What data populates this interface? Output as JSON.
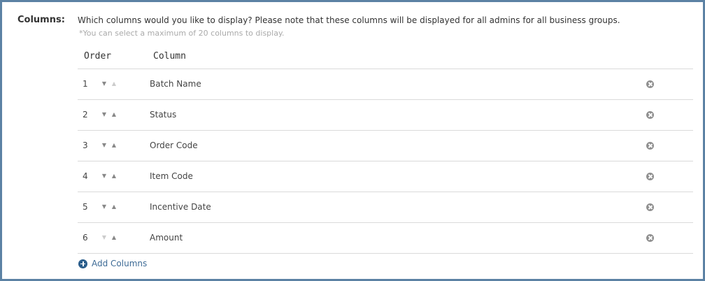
{
  "section_label": "Columns:",
  "description": "Which columns would you like to display? Please note that these columns will be displayed for all admins for all business groups.",
  "note": "*You can select a maximum of 20 columns to display.",
  "headers": {
    "order": "Order",
    "column": "Column"
  },
  "rows": [
    {
      "order": "1",
      "name": "Batch Name",
      "down_enabled": true,
      "up_enabled": false
    },
    {
      "order": "2",
      "name": "Status",
      "down_enabled": true,
      "up_enabled": true
    },
    {
      "order": "3",
      "name": "Order Code",
      "down_enabled": true,
      "up_enabled": true
    },
    {
      "order": "4",
      "name": "Item Code",
      "down_enabled": true,
      "up_enabled": true
    },
    {
      "order": "5",
      "name": "Incentive Date",
      "down_enabled": true,
      "up_enabled": true
    },
    {
      "order": "6",
      "name": "Amount",
      "down_enabled": false,
      "up_enabled": true
    }
  ],
  "add_label": "Add Columns",
  "colors": {
    "border": "#5c82a4",
    "link": "#3d6b96",
    "icon": "#8f8f8f"
  },
  "icons": {
    "move_down": "caret-down-icon",
    "move_up": "caret-up-icon",
    "remove": "remove-circle-icon",
    "add": "plus-circle-icon"
  }
}
